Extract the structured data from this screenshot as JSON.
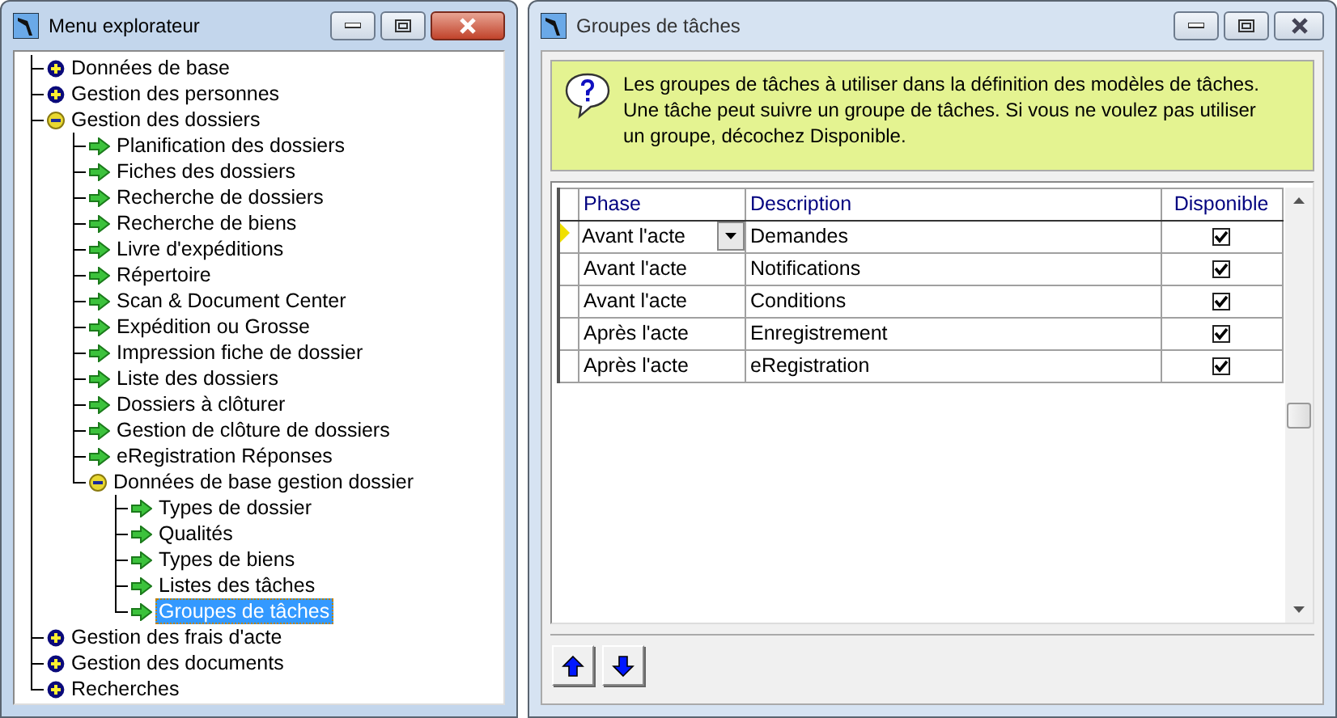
{
  "explorer": {
    "title": "Menu explorateur",
    "active": true,
    "tree": [
      {
        "label": "Données de base",
        "kind": "folder",
        "expanded": false,
        "selected": false
      },
      {
        "label": "Gestion des personnes",
        "kind": "folder",
        "expanded": false,
        "selected": false
      },
      {
        "label": "Gestion des dossiers",
        "kind": "folder",
        "expanded": true,
        "selected": false,
        "children": [
          {
            "label": "Planification des dossiers",
            "kind": "leaf",
            "selected": false
          },
          {
            "label": "Fiches des dossiers",
            "kind": "leaf",
            "selected": false
          },
          {
            "label": "Recherche de dossiers",
            "kind": "leaf",
            "selected": false
          },
          {
            "label": "Recherche de biens",
            "kind": "leaf",
            "selected": false
          },
          {
            "label": "Livre d'expéditions",
            "kind": "leaf",
            "selected": false
          },
          {
            "label": "Répertoire",
            "kind": "leaf",
            "selected": false
          },
          {
            "label": "Scan & Document Center",
            "kind": "leaf",
            "selected": false
          },
          {
            "label": "Expédition ou Grosse",
            "kind": "leaf",
            "selected": false
          },
          {
            "label": "Impression fiche de dossier",
            "kind": "leaf",
            "selected": false
          },
          {
            "label": "Liste des dossiers",
            "kind": "leaf",
            "selected": false
          },
          {
            "label": "Dossiers à clôturer",
            "kind": "leaf",
            "selected": false
          },
          {
            "label": "Gestion de clôture de dossiers",
            "kind": "leaf",
            "selected": false
          },
          {
            "label": "eRegistration Réponses",
            "kind": "leaf",
            "selected": false
          },
          {
            "label": "Données de base gestion dossier",
            "kind": "folder",
            "expanded": true,
            "selected": false,
            "children": [
              {
                "label": "Types de dossier",
                "kind": "leaf",
                "selected": false
              },
              {
                "label": "Qualités",
                "kind": "leaf",
                "selected": false
              },
              {
                "label": "Types de biens",
                "kind": "leaf",
                "selected": false
              },
              {
                "label": "Listes des tâches",
                "kind": "leaf",
                "selected": false
              },
              {
                "label": "Groupes de tâches",
                "kind": "leaf",
                "selected": true
              }
            ]
          }
        ]
      },
      {
        "label": "Gestion des frais d'acte",
        "kind": "folder",
        "expanded": false,
        "selected": false
      },
      {
        "label": "Gestion des documents",
        "kind": "folder",
        "expanded": false,
        "selected": false
      },
      {
        "label": "Recherches",
        "kind": "folder",
        "expanded": false,
        "selected": false
      }
    ]
  },
  "task_groups": {
    "title": "Groupes de tâches",
    "active": false,
    "info": "Les groupes de tâches à utiliser dans la définition des modèles de tâches.  Une tâche peut suivre un groupe de tâches.  Si vous ne voulez pas utiliser un groupe, décochez Disponible.",
    "table": {
      "columns": [
        "Phase",
        "Description",
        "Disponible"
      ],
      "rows": [
        {
          "phase": "Avant l'acte",
          "description": "Demandes",
          "available": true,
          "current": true
        },
        {
          "phase": "Avant l'acte",
          "description": "Notifications",
          "available": true,
          "current": false
        },
        {
          "phase": "Avant l'acte",
          "description": "Conditions",
          "available": true,
          "current": false
        },
        {
          "phase": "Après l'acte",
          "description": "Enregistrement",
          "available": true,
          "current": false
        },
        {
          "phase": "Après l'acte",
          "description": "eRegistration",
          "available": true,
          "current": false
        }
      ]
    }
  }
}
